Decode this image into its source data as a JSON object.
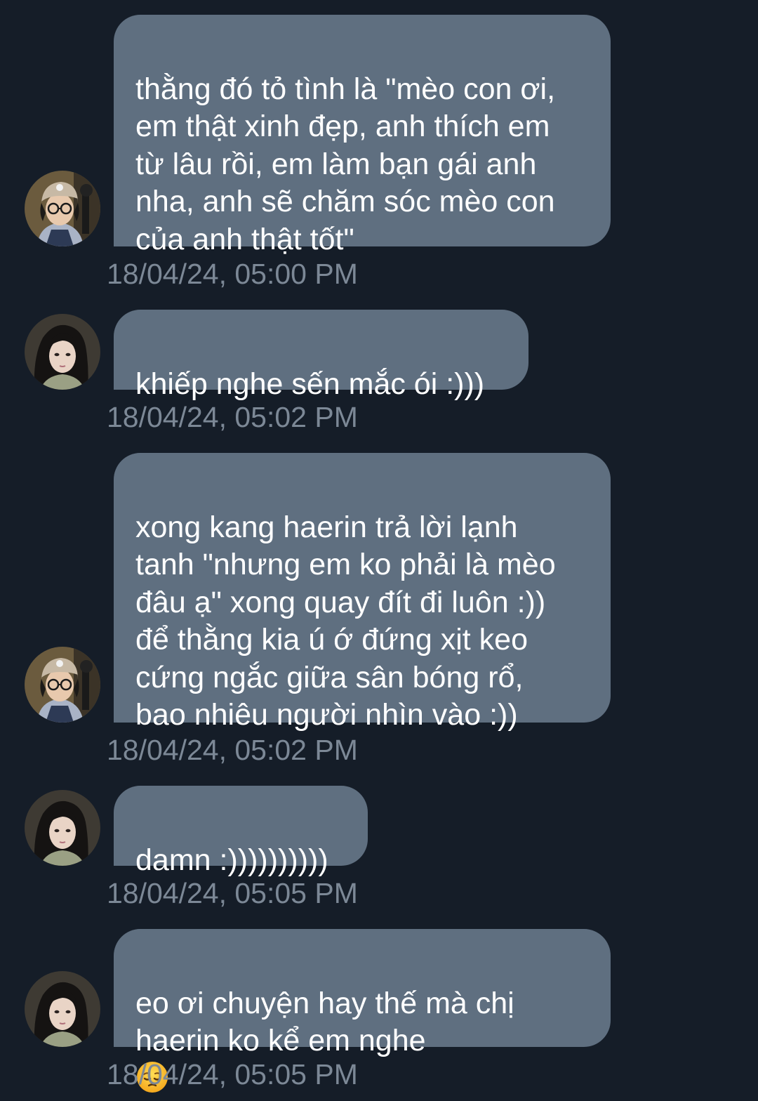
{
  "messages": [
    {
      "sender": "left",
      "avatar": "avatar-beanie-glasses",
      "text": "thằng đó tỏ tình là \"mèo con ơi,\nem thật xinh đẹp, anh thích em\ntừ lâu rồi, em làm bạn gái anh\nnha, anh sẽ chăm sóc mèo con\ncủa anh thật tốt\"",
      "timestamp": "18/04/24, 05:00 PM"
    },
    {
      "sender": "left",
      "avatar": "avatar-long-hair",
      "text": "khiếp nghe sến mắc ói :)))",
      "timestamp": "18/04/24, 05:02 PM"
    },
    {
      "sender": "left",
      "avatar": "avatar-beanie-glasses",
      "text": "xong kang haerin trả lời lạnh\ntanh \"nhưng em ko phải là mèo\nđâu ạ\" xong quay đít đi luôn :))\nđể thằng kia ú ớ đứng xịt keo\ncứng ngắc giữa sân bóng rổ,\nbao nhiêu người nhìn vào :))",
      "timestamp": "18/04/24, 05:02 PM"
    },
    {
      "sender": "left",
      "avatar": "avatar-long-hair",
      "text": "damn :))))))))))",
      "timestamp": "18/04/24, 05:05 PM"
    },
    {
      "sender": "left",
      "avatar": "avatar-long-hair",
      "text": "eo ơi chuyện hay thế mà chị\nhaerin ko kể em nghe",
      "emoji": "pensive-face-emoji",
      "timestamp": "18/04/24, 05:05 PM"
    }
  ],
  "colors": {
    "background": "#151d28",
    "bubble": "#5f6f80",
    "text": "#ffffff",
    "timestamp": "#7c8896"
  }
}
